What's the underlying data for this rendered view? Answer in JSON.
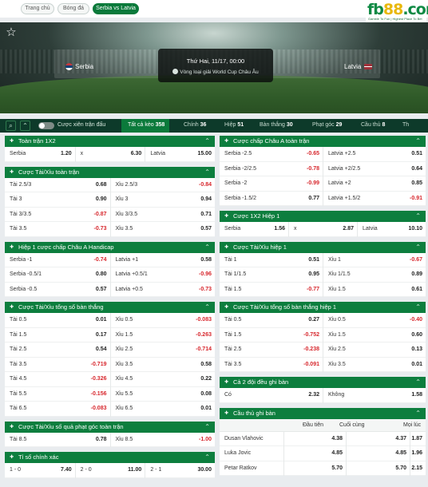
{
  "breadcrumb": [
    "Trang chủ",
    "Bóng đá",
    "Serbia vs Latvia"
  ],
  "logo": {
    "text": "fb88",
    "tagline": "Gamble To Fun | Highest Place To Bet"
  },
  "match": {
    "home": "Serbia",
    "away": "Latvia",
    "datetime": "Thứ Hai, 11/17, 00:00",
    "league": "Vòng loại giải World Cup Châu Âu"
  },
  "filters": {
    "parlay_label": "Cược xiên trận đấu",
    "categories": [
      {
        "label": "Tất cả kèo",
        "count": "358",
        "active": true
      },
      {
        "label": "Chính",
        "count": "36"
      },
      {
        "label": "Hiệp",
        "count": "51"
      },
      {
        "label": "Bàn thắng",
        "count": "30"
      },
      {
        "label": "Phạt góc",
        "count": "29"
      },
      {
        "label": "Cầu thủ",
        "count": "8"
      },
      {
        "label": "Th",
        "count": ""
      }
    ]
  },
  "left_markets": [
    {
      "title": "Toàn trận 1X2",
      "rows": [
        [
          {
            "l": "Serbia",
            "o": "1.20"
          },
          {
            "l": "x",
            "o": "6.30"
          },
          {
            "l": "Latvia",
            "o": "15.00"
          }
        ]
      ]
    },
    {
      "title": "Cược Tài/Xỉu toàn trận",
      "rows": [
        [
          {
            "l": "Tài 2.5/3",
            "o": "0.68"
          },
          {
            "l": "Xỉu 2.5/3",
            "o": "-0.84"
          }
        ],
        [
          {
            "l": "Tài 3",
            "o": "0.90"
          },
          {
            "l": "Xỉu 3",
            "o": "0.94"
          }
        ],
        [
          {
            "l": "Tài 3/3.5",
            "o": "-0.87"
          },
          {
            "l": "Xỉu 3/3.5",
            "o": "0.71"
          }
        ],
        [
          {
            "l": "Tài 3.5",
            "o": "-0.73"
          },
          {
            "l": "Xỉu 3.5",
            "o": "0.57"
          }
        ]
      ]
    },
    {
      "title": "Hiệp 1 cược chấp Châu A Handicap",
      "rows": [
        [
          {
            "l": "Serbia -1",
            "o": "-0.74"
          },
          {
            "l": "Latvia +1",
            "o": "0.58"
          }
        ],
        [
          {
            "l": "Serbia -0.5/1",
            "o": "0.80"
          },
          {
            "l": "Latvia +0.5/1",
            "o": "-0.96"
          }
        ],
        [
          {
            "l": "Serbia -0.5",
            "o": "0.57"
          },
          {
            "l": "Latvia +0.5",
            "o": "-0.73"
          }
        ]
      ]
    },
    {
      "title": "Cược Tài/Xỉu tổng số bàn thắng",
      "rows": [
        [
          {
            "l": "Tài 0.5",
            "o": "0.01"
          },
          {
            "l": "Xỉu 0.5",
            "o": "-0.083"
          }
        ],
        [
          {
            "l": "Tài 1.5",
            "o": "0.17"
          },
          {
            "l": "Xỉu 1.5",
            "o": "-0.263"
          }
        ],
        [
          {
            "l": "Tài 2.5",
            "o": "0.54"
          },
          {
            "l": "Xỉu 2.5",
            "o": "-0.714"
          }
        ],
        [
          {
            "l": "Tài 3.5",
            "o": "-0.719"
          },
          {
            "l": "Xỉu 3.5",
            "o": "0.58"
          }
        ],
        [
          {
            "l": "Tài 4.5",
            "o": "-0.326"
          },
          {
            "l": "Xỉu 4.5",
            "o": "0.22"
          }
        ],
        [
          {
            "l": "Tài 5.5",
            "o": "-0.156"
          },
          {
            "l": "Xỉu 5.5",
            "o": "0.08"
          }
        ],
        [
          {
            "l": "Tài 6.5",
            "o": "-0.083"
          },
          {
            "l": "Xỉu 6.5",
            "o": "0.01"
          }
        ]
      ]
    },
    {
      "title": "Cược Tài/Xỉu số quả phạt góc toàn trận",
      "rows": [
        [
          {
            "l": "Tài 8.5",
            "o": "0.78"
          },
          {
            "l": "Xỉu 8.5",
            "o": "-1.00"
          }
        ]
      ]
    },
    {
      "title": "Tỉ số chính xác",
      "rows": [
        [
          {
            "l": "1 - 0",
            "o": "7.40"
          },
          {
            "l": "2 - 0",
            "o": "11.00"
          },
          {
            "l": "2 - 1",
            "o": "30.00"
          }
        ]
      ]
    }
  ],
  "right_markets": [
    {
      "title": "Cược chấp Châu A toàn trận",
      "rows": [
        [
          {
            "l": "Serbia -2.5",
            "o": "-0.65"
          },
          {
            "l": "Latvia +2.5",
            "o": "0.51"
          }
        ],
        [
          {
            "l": "Serbia -2/2.5",
            "o": "-0.78"
          },
          {
            "l": "Latvia +2/2.5",
            "o": "0.64"
          }
        ],
        [
          {
            "l": "Serbia -2",
            "o": "-0.99"
          },
          {
            "l": "Latvia +2",
            "o": "0.85"
          }
        ],
        [
          {
            "l": "Serbia -1.5/2",
            "o": "0.77"
          },
          {
            "l": "Latvia +1.5/2",
            "o": "-0.91"
          }
        ]
      ]
    },
    {
      "title": "Cược 1X2 Hiệp 1",
      "rows": [
        [
          {
            "l": "Serbia",
            "o": "1.56"
          },
          {
            "l": "x",
            "o": "2.87"
          },
          {
            "l": "Latvia",
            "o": "10.10"
          }
        ]
      ]
    },
    {
      "title": "Cược Tài/Xỉu hiệp 1",
      "rows": [
        [
          {
            "l": "Tài 1",
            "o": "0.51"
          },
          {
            "l": "Xỉu 1",
            "o": "-0.67"
          }
        ],
        [
          {
            "l": "Tài 1/1.5",
            "o": "0.95"
          },
          {
            "l": "Xỉu 1/1.5",
            "o": "0.89"
          }
        ],
        [
          {
            "l": "Tài 1.5",
            "o": "-0.77"
          },
          {
            "l": "Xỉu 1.5",
            "o": "0.61"
          }
        ]
      ]
    },
    {
      "title": "Cược Tài/Xỉu tổng số bàn thắng hiệp 1",
      "rows": [
        [
          {
            "l": "Tài 0.5",
            "o": "0.27"
          },
          {
            "l": "Xỉu 0.5",
            "o": "-0.40"
          }
        ],
        [
          {
            "l": "Tài 1.5",
            "o": "-0.752"
          },
          {
            "l": "Xỉu 1.5",
            "o": "0.60"
          }
        ],
        [
          {
            "l": "Tài 2.5",
            "o": "-0.238"
          },
          {
            "l": "Xỉu 2.5",
            "o": "0.13"
          }
        ],
        [
          {
            "l": "Tài 3.5",
            "o": "-0.091"
          },
          {
            "l": "Xỉu 3.5",
            "o": "0.01"
          }
        ]
      ]
    },
    {
      "title": "Cả 2 đội đều ghi bàn",
      "rows": [
        [
          {
            "l": "Có",
            "o": "2.32"
          },
          {
            "l": "Không",
            "o": "1.58"
          }
        ]
      ]
    },
    {
      "title": "Cầu thủ ghi bàn",
      "columns": [
        "Đầu tiên",
        "Cuối cùng",
        "Mọi lúc"
      ],
      "players": [
        {
          "name": "Dusan Vlahovic",
          "odds": [
            "4.38",
            "4.37",
            "1.87"
          ]
        },
        {
          "name": "Luka Jovic",
          "odds": [
            "4.85",
            "4.85",
            "1.96"
          ]
        },
        {
          "name": "Petar Ratkov",
          "odds": [
            "5.70",
            "5.70",
            "2.15"
          ]
        }
      ]
    }
  ],
  "colors": {
    "primary": "#0d7e3e",
    "dark": "#0d3a2a",
    "negative": "#d7262c"
  },
  "icons": {
    "star": "star-icon",
    "search": "search-icon",
    "collapse": "double-chevron-up-icon",
    "pin": "pin-icon",
    "chevron": "chevron-up-icon"
  }
}
